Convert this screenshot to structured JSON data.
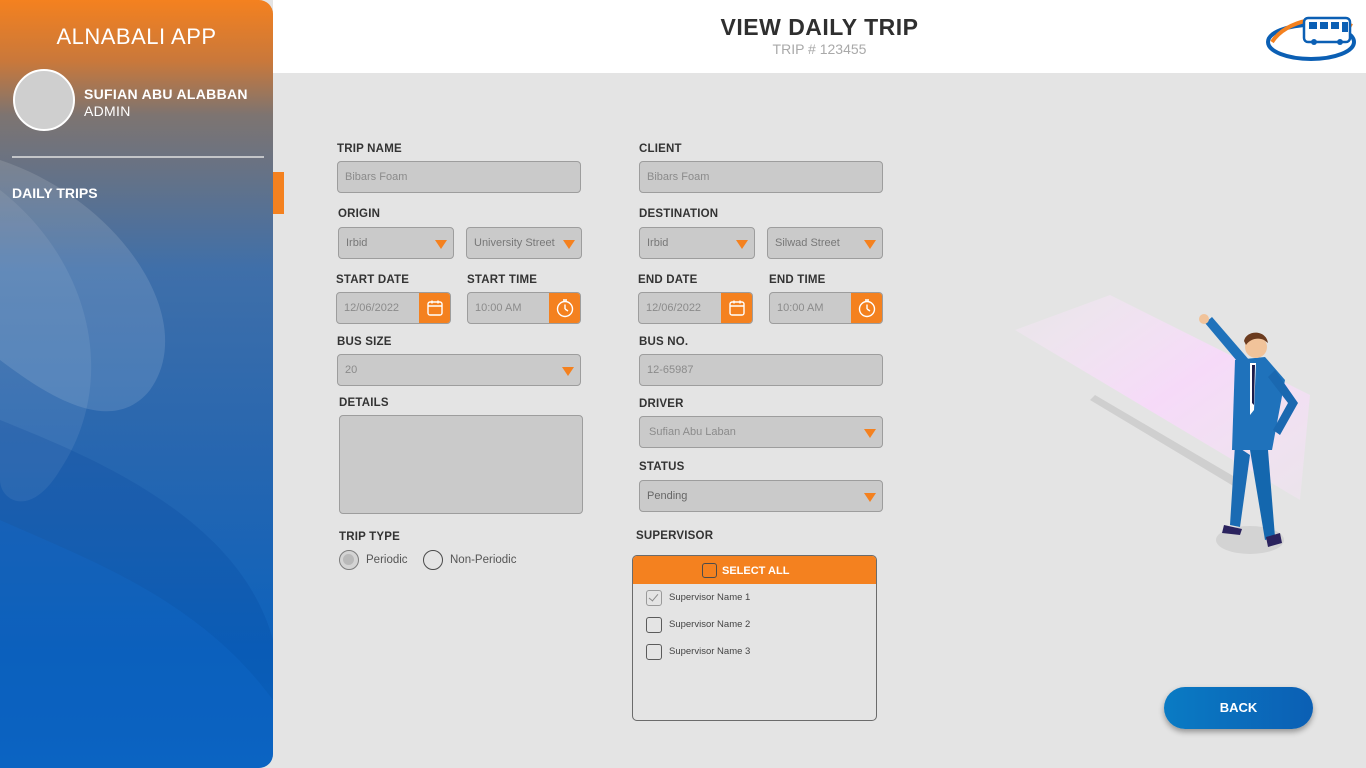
{
  "sidebar": {
    "app_title": "ALNABALI APP",
    "user_name": "SUFIAN ABU ALABBAN",
    "user_role": "ADMIN",
    "nav_items": [
      {
        "label": "DAILY TRIPS",
        "active": true
      }
    ]
  },
  "header": {
    "title": "VIEW DAILY TRIP",
    "subtitle": "TRIP # 123455"
  },
  "form": {
    "trip_name": {
      "label": "TRIP NAME",
      "placeholder": "Bibars Foam"
    },
    "client": {
      "label": "CLIENT",
      "placeholder": "Bibars Foam"
    },
    "origin": {
      "label": "ORIGIN",
      "city": "Irbid",
      "street": "University Street"
    },
    "destination": {
      "label": "DESTINATION",
      "city": "Irbid",
      "street": "Silwad Street"
    },
    "start_date": {
      "label": "START DATE",
      "value": "12/06/2022"
    },
    "start_time": {
      "label": "START TIME",
      "value": "10:00 AM"
    },
    "end_date": {
      "label": "END DATE",
      "value": "12/06/2022"
    },
    "end_time": {
      "label": "END TIME",
      "value": "10:00 AM"
    },
    "bus_size": {
      "label": "BUS SIZE",
      "value": "20"
    },
    "bus_no": {
      "label": "BUS NO.",
      "value": "12-65987"
    },
    "details": {
      "label": "DETAILS",
      "value": ""
    },
    "driver": {
      "label": "DRIVER",
      "value": "Sufian Abu Laban"
    },
    "status": {
      "label": "STATUS",
      "value": "Pending"
    },
    "trip_type": {
      "label": "TRIP TYPE",
      "options": [
        "Periodic",
        "Non-Periodic"
      ],
      "selected": "Periodic"
    },
    "supervisor": {
      "label": "SUPERVISOR",
      "select_all": "SELECT ALL",
      "items": [
        {
          "name": "Supervisor Name 1",
          "checked": true
        },
        {
          "name": "Supervisor Name 2",
          "checked": false
        },
        {
          "name": "Supervisor Name 3",
          "checked": false
        }
      ]
    }
  },
  "actions": {
    "back_label": "BACK"
  },
  "colors": {
    "accent": "#f4811f",
    "primary_blue": "#0b63bd",
    "field_bg": "#cacaca"
  },
  "icons": [
    "calendar-icon",
    "clock-icon",
    "dropdown-arrow-icon",
    "company-bus-logo"
  ]
}
